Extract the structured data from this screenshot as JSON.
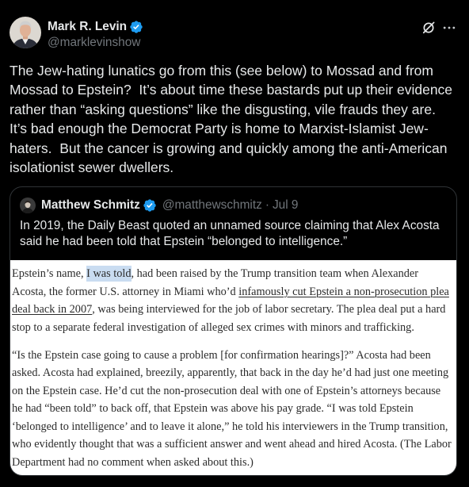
{
  "post": {
    "author": {
      "name": "Mark R. Levin",
      "handle": "@marklevinshow",
      "avatar_icon": "author-avatar",
      "verified_icon": "verified-badge-icon"
    },
    "actions": {
      "grok_icon": "grok-icon",
      "more_icon": "more-horizontal-icon"
    },
    "text_lines": [
      "The Jew-hating lunatics go from this (see below) to Mossad and from",
      "Mossad to Epstein?  It’s about time these bastards put up their evidence",
      "rather than “asking questions” like the disgusting, vile frauds they are.",
      "It’s bad enough the Democrat Party is home to Marxist-Islamist Jew-",
      "haters.  But the cancer is growing and quickly among the anti-American",
      "isolationist sewer dwellers."
    ]
  },
  "quoted_post": {
    "author": {
      "name": "Matthew Schmitz",
      "handle": "@matthewschmitz",
      "separator": "·",
      "date": "Jul 9",
      "verified_icon": "verified-badge-icon"
    },
    "text_lines": [
      "In 2019, the Daily Beast quoted an unnamed source claiming that Alex Acosta",
      "said he had been told that Epstein “belonged to intelligence.”"
    ],
    "image": {
      "paragraph_1": [
        [
          "Epstein’s name, ",
          "I was told",
          ", had been raised by the Trump transition team when Alexander"
        ],
        [
          "Acosta, the former U.S. attorney in Miami who’d ",
          "infamously cut Epstein a non-prosecution plea"
        ],
        [
          "deal back in 2007",
          ", was being interviewed for the job of labor secretary. The plea deal put a hard"
        ],
        [
          "stop to a separate federal investigation of alleged sex crimes with minors and trafficking."
        ]
      ],
      "paragraph_2": [
        "“Is the Epstein case going to cause a problem [for confirmation hearings]?” Acosta had been",
        "asked. Acosta had explained, breezily, apparently, that back in the day he’d had just one meeting",
        "on the Epstein case. He’d cut the non-prosecution deal with one of Epstein’s attorneys because",
        "he had “been told” to back off, that Epstein was above his pay grade. “I was told Epstein",
        "‘belonged to intelligence’ and to leave it alone,” he told his interviewers in the Trump transition,",
        "who evidently thought that was a sufficient answer and went ahead and hired Acosta. (The Labor",
        "Department had no comment when asked about this.)"
      ]
    }
  },
  "colors": {
    "background": "#000000",
    "text": "#e7e9ea",
    "secondary_text": "#71767b",
    "border": "#2f3336",
    "verified": "#1d9bf0",
    "excerpt_text": "#2b2b2b",
    "excerpt_highlight": "#c9dcf1"
  }
}
